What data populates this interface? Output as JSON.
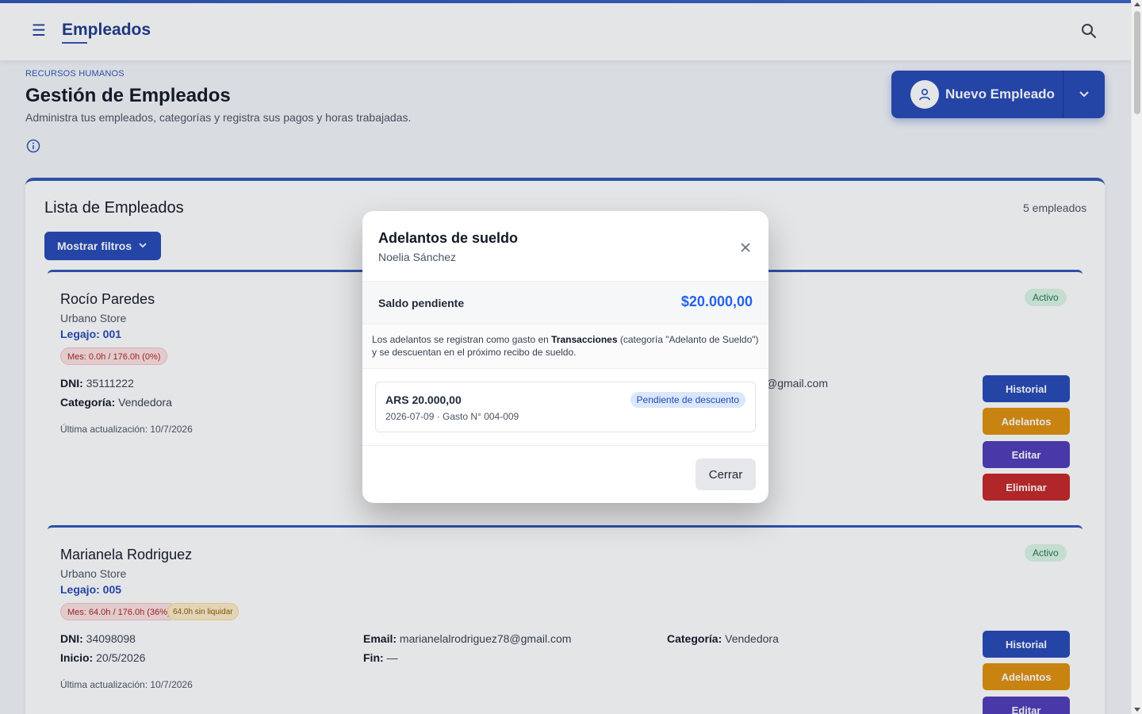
{
  "topbar": {
    "title": "Empleados",
    "menu_icon": "hamburger-menu-icon",
    "search_icon": "search-icon"
  },
  "header": {
    "kicker": "RECURSOS HUMANOS",
    "title": "Gestión de Empleados",
    "subtitle": "Administra tus empleados, categorías y registra sus pagos y horas trabajadas.",
    "info_icon": "info-icon",
    "new_button_label": "Nuevo Empleado"
  },
  "list": {
    "title": "Lista de Empleados",
    "count": "5 empleados",
    "filters_label": "Mostrar filtros"
  },
  "employees": [
    {
      "name": "Rocío Paredes",
      "company": "Urbano Store",
      "legajo": "Legajo: 001",
      "hours_pill": "Mes: 0.0h / 176.0h (0%)",
      "status": "Activo",
      "dni_label": "DNI:",
      "dni": "35111222",
      "category_label": "Categoría:",
      "category": "Vendedora",
      "email_partial": "@gmail.com",
      "updated": "Última actualización: 10/7/2026"
    },
    {
      "name": "Marianela Rodriguez",
      "company": "Urbano Store",
      "legajo": "Legajo: 005",
      "hours_pill": "Mes: 64.0h / 176.0h (36%)",
      "unsettled_pill": "64.0h sin liquidar",
      "status": "Activo",
      "dni_label": "DNI:",
      "dni": "34098098",
      "start_label": "Inicio:",
      "start": "20/5/2026",
      "email_label": "Email:",
      "email": "marianelalrodriguez78@gmail.com",
      "end_label": "Fin:",
      "end": "—",
      "category_label": "Categoría:",
      "category": "Vendedora",
      "updated": "Última actualización: 10/7/2026"
    }
  ],
  "actions": {
    "history": "Historial",
    "advances": "Adelantos",
    "edit": "Editar",
    "delete": "Eliminar"
  },
  "modal": {
    "title": "Adelantos de sueldo",
    "employee": "Noelia Sánchez",
    "balance_label": "Saldo pendiente",
    "balance_value": "$20.000,00",
    "notice_pre": "Los adelantos se registran como gasto en ",
    "notice_bold": "Transacciones",
    "notice_post": " (categoría \"Adelanto de Sueldo\") y se descuentan en el próximo recibo de sueldo.",
    "item": {
      "amount": "ARS 20.000,00",
      "meta": "2026-07-09 · Gasto N° 004-009",
      "badge": "Pendiente de descuento"
    },
    "close_label": "Cerrar"
  },
  "colors": {
    "primary": "#2548b5",
    "amber": "#e0900b",
    "violet": "#4f3bb7",
    "danger": "#c52626",
    "accent_value": "#2563eb"
  }
}
